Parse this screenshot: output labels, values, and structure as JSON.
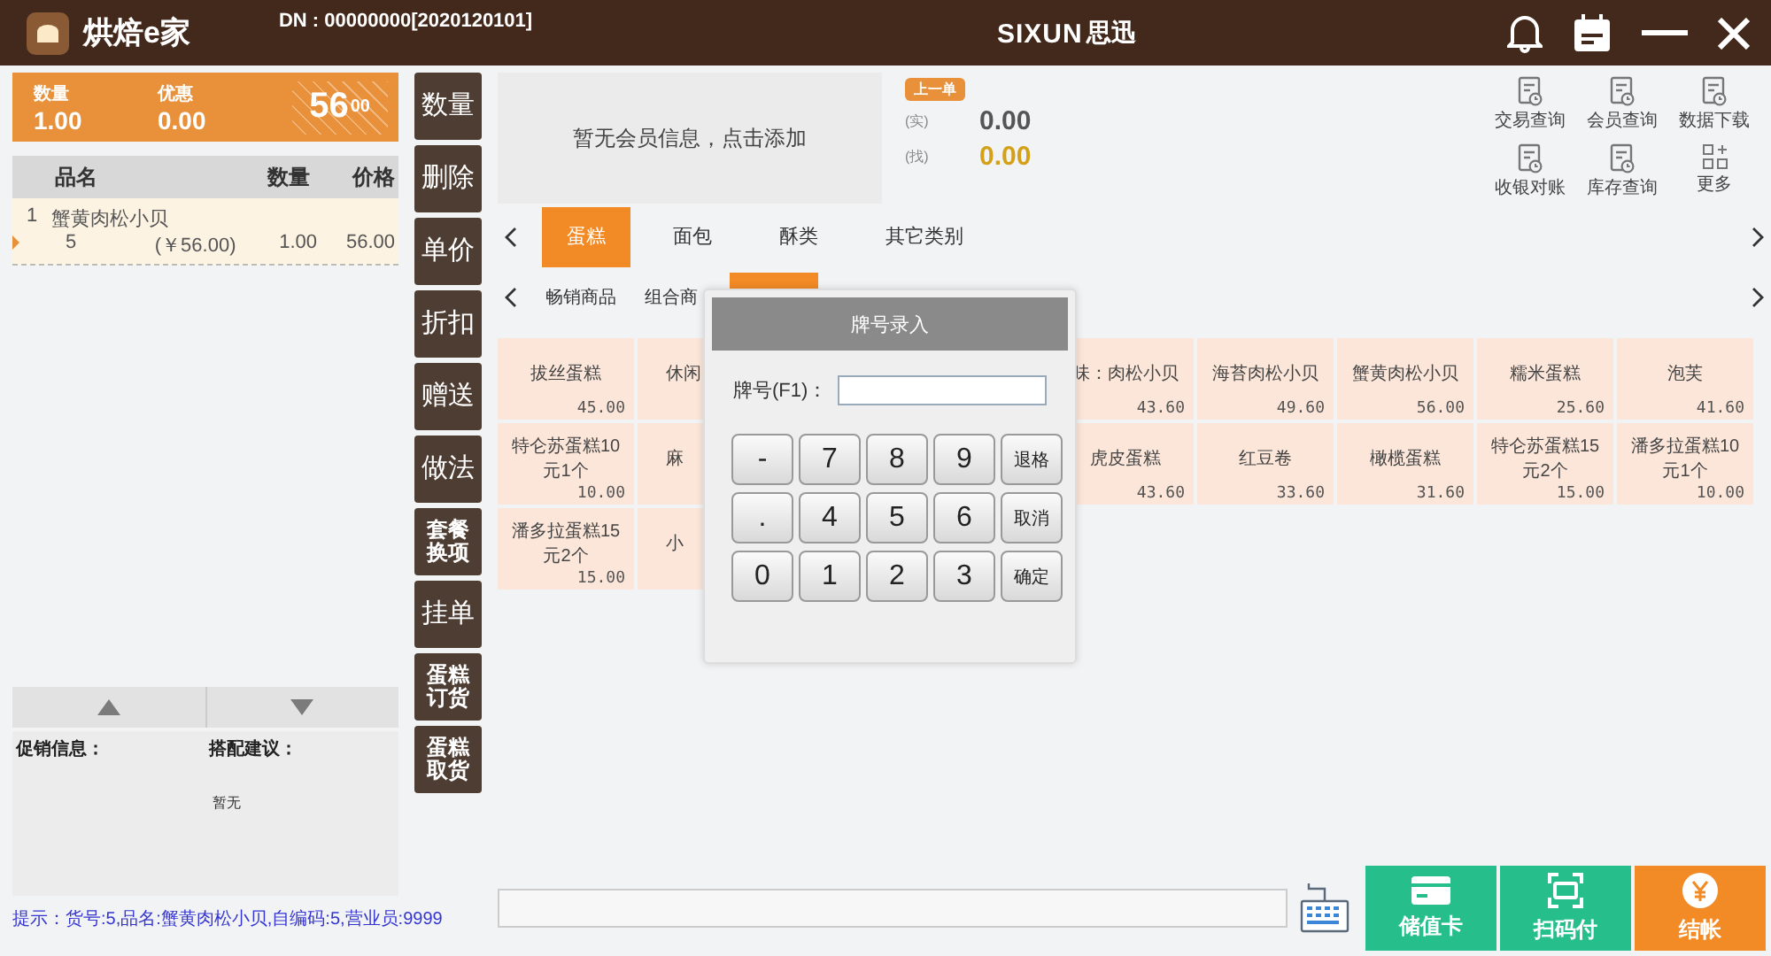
{
  "header": {
    "app_name": "烘焙e家",
    "dn": "DN : 00000000[2020120101]",
    "brand": "SIXUN",
    "brand_cn": "思迅"
  },
  "summary": {
    "qty_label": "数量",
    "qty": "1.00",
    "discount_label": "优惠",
    "discount": "0.00",
    "total": "56",
    "total_cents": "00"
  },
  "order_table": {
    "columns": [
      "品名",
      "数量",
      "价格"
    ],
    "rows": [
      {
        "index": "1",
        "name": "蟹黄肉松小贝",
        "code": "5",
        "unit_price": "(￥56.00)",
        "qty": "1.00",
        "price": "56.00",
        "selected": true
      }
    ]
  },
  "promo": {
    "promo_label": "促销信息：",
    "match_label": "搭配建议：",
    "match_value": "暂无"
  },
  "status_line": "提示：货号:5,品名:蟹黄肉松小贝,自编码:5,营业员:9999",
  "functions": [
    "数量",
    "删除",
    "单价",
    "折扣",
    "赠送",
    "做法",
    "套餐换项",
    "挂单",
    "蛋糕订货",
    "蛋糕取货"
  ],
  "member": {
    "prompt": "暂无会员信息，点击添加"
  },
  "last_order": {
    "badge": "上一单",
    "paid_label": "(实)",
    "paid": "0.00",
    "change_label": "(找)",
    "change": "0.00"
  },
  "quick_links": [
    {
      "label": "交易查询",
      "kind": "report"
    },
    {
      "label": "会员查询",
      "kind": "report"
    },
    {
      "label": "数据下载",
      "kind": "report"
    },
    {
      "label": "收银对账",
      "kind": "report"
    },
    {
      "label": "库存查询",
      "kind": "report"
    },
    {
      "label": "更多",
      "kind": "apps"
    }
  ],
  "categories": [
    {
      "label": "蛋糕",
      "selected": true
    },
    {
      "label": "面包",
      "selected": false
    },
    {
      "label": "酥类",
      "selected": false
    },
    {
      "label": "其它类别",
      "selected": false
    }
  ],
  "subcategories": [
    {
      "label": "畅销商品",
      "selected": false
    },
    {
      "label": "组合商",
      "selected": false
    },
    {
      "selected": true
    }
  ],
  "products": [
    {
      "kind": "item",
      "name": "拔丝蛋糕",
      "price": "45.00"
    },
    {
      "kind": "partial",
      "name": "休闲"
    },
    {
      "kind": "hidden"
    },
    {
      "kind": "hidden"
    },
    {
      "kind": "item",
      "name": "味：肉松小贝",
      "price": "43.60"
    },
    {
      "kind": "item",
      "name": "海苔肉松小贝",
      "price": "49.60"
    },
    {
      "kind": "item",
      "name": "蟹黄肉松小贝",
      "price": "56.00"
    },
    {
      "kind": "item",
      "name": "糯米蛋糕",
      "price": "25.60"
    },
    {
      "kind": "item",
      "name": "泡芙",
      "price": "41.60"
    },
    {
      "kind": "item",
      "name": "特仑苏蛋糕10元1个",
      "price": "10.00"
    },
    {
      "kind": "partial",
      "name": "麻"
    },
    {
      "kind": "hidden"
    },
    {
      "kind": "hidden"
    },
    {
      "kind": "item",
      "name": "虎皮蛋糕",
      "price": "43.60"
    },
    {
      "kind": "item",
      "name": "红豆卷",
      "price": "33.60"
    },
    {
      "kind": "item",
      "name": "橄榄蛋糕",
      "price": "31.60"
    },
    {
      "kind": "item",
      "name": "特仑苏蛋糕15元2个",
      "price": "15.00"
    },
    {
      "kind": "item",
      "name": "潘多拉蛋糕10元1个",
      "price": "10.00"
    },
    {
      "kind": "item",
      "name": "潘多拉蛋糕15元2个",
      "price": "15.00"
    },
    {
      "kind": "partial",
      "name": "小"
    },
    {
      "kind": "hidden"
    },
    {
      "kind": "hidden"
    }
  ],
  "dialog": {
    "title": "牌号录入",
    "field_label": "牌号(F1)：",
    "keys": [
      {
        "label": "-",
        "kind": "digit"
      },
      {
        "label": "7",
        "kind": "digit"
      },
      {
        "label": "8",
        "kind": "digit"
      },
      {
        "label": "9",
        "kind": "digit"
      },
      {
        "label": "退格",
        "kind": "action"
      },
      {
        "label": ".",
        "kind": "digit"
      },
      {
        "label": "4",
        "kind": "digit"
      },
      {
        "label": "5",
        "kind": "digit"
      },
      {
        "label": "6",
        "kind": "digit"
      },
      {
        "label": "取消",
        "kind": "action"
      },
      {
        "label": "0",
        "kind": "digit"
      },
      {
        "label": "1",
        "kind": "digit"
      },
      {
        "label": "2",
        "kind": "digit"
      },
      {
        "label": "3",
        "kind": "digit"
      },
      {
        "label": "确定",
        "kind": "action"
      }
    ]
  },
  "pay_buttons": [
    {
      "label": "储值卡",
      "kind": "card"
    },
    {
      "label": "扫码付",
      "kind": "scan"
    },
    {
      "label": "结帐",
      "kind": "checkout"
    }
  ]
}
